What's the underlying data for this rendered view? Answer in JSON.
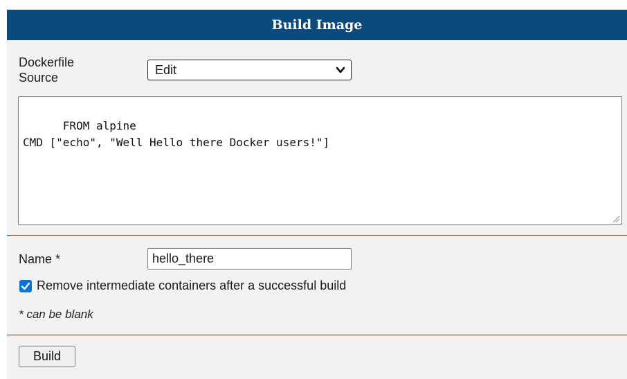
{
  "header": {
    "title": "Build Image"
  },
  "dockerfile": {
    "label_line1": "Dockerfile",
    "label_line2": "Source",
    "source_value": "Edit",
    "content": "FROM alpine\nCMD [\"echo\", \"Well Hello there Docker users!\"]"
  },
  "name_field": {
    "label": "Name *",
    "value": "hello_there"
  },
  "remove_intermediate": {
    "checked": true,
    "label": "Remove intermediate containers after a successful build"
  },
  "note": "* can be blank",
  "build_button": {
    "label": "Build"
  },
  "colors": {
    "header_bg": "#0a4a7d",
    "panel_bg": "#f2f2f2",
    "checkbox_accent": "#0075d7"
  },
  "icons": {
    "select_arrow": "chevron-down-icon",
    "checkbox_mark": "checkmark-icon",
    "resize": "resize-grip-icon"
  }
}
